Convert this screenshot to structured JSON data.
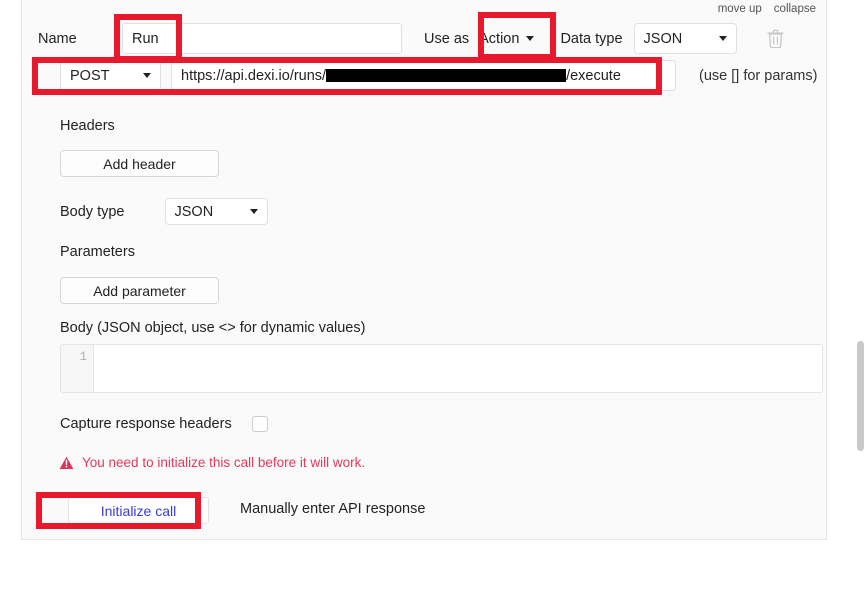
{
  "utility": {
    "move_up": "move up",
    "collapse": "collapse"
  },
  "call": {
    "name_label": "Name",
    "name_value": "Run",
    "name_placeholder": "",
    "use_as_label": "Use as",
    "use_as_value": "Action",
    "data_type_label": "Data type",
    "data_type_value": "JSON",
    "delete_icon": "trash-icon",
    "method_value": "POST",
    "url_prefix": "https://api.dexi.io/runs/",
    "url_redacted": "████████████████",
    "url_suffix": "/execute",
    "params_hint": "(use [] for params)"
  },
  "headers": {
    "label": "Headers",
    "add_button": "Add header"
  },
  "body_type": {
    "label": "Body type",
    "value": "JSON"
  },
  "parameters": {
    "label": "Parameters",
    "add_button": "Add parameter"
  },
  "body": {
    "label": "Body (JSON object, use <> for dynamic values)",
    "line_number": "1",
    "content": ""
  },
  "capture": {
    "label": "Capture response headers",
    "checked": false
  },
  "warning": {
    "icon": "warning-triangle-icon",
    "text": "You need to initialize this call before it will work."
  },
  "actions": {
    "initialize": "Initialize call",
    "manual": "Manually enter API response"
  },
  "colors": {
    "highlight": "#e8192c",
    "warning": "#e03a5f",
    "link": "#3b3bd0",
    "card_bg": "#fafafa"
  }
}
